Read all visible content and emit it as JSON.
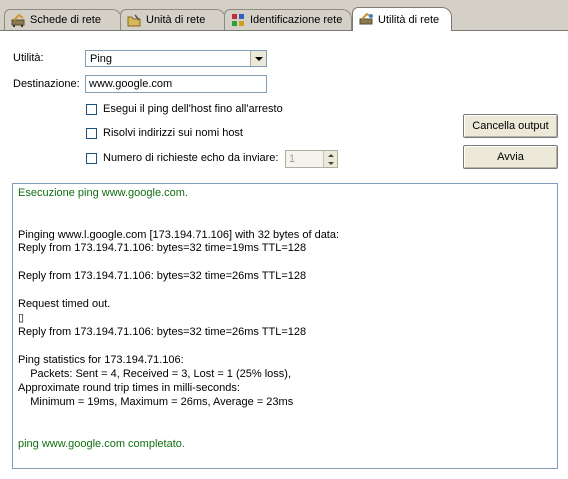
{
  "tabs": [
    {
      "label": "Schede di rete",
      "icon": "network-card-icon",
      "active": false
    },
    {
      "label": "Unità di rete",
      "icon": "folder-icon",
      "active": false
    },
    {
      "label": "Identificazione rete",
      "icon": "network-id-icon",
      "active": false
    },
    {
      "label": "Utilità di rete",
      "icon": "network-tools-icon",
      "active": true
    }
  ],
  "form": {
    "utility_label": "Utilità:",
    "utility_value": "Ping",
    "destination_label": "Destinazione:",
    "destination_value": "www.google.com",
    "checkbox_continuous": "Esegui il ping dell'host fino all'arresto",
    "checkbox_resolve": "Risolvi indirizzi sui nomi host",
    "checkbox_count": "Numero di richieste echo da inviare:",
    "count_value": "1"
  },
  "buttons": {
    "clear_output": "Cancella output",
    "start": "Avvia"
  },
  "output": {
    "start_line": "Esecuzione ping www.google.com.",
    "lines": [
      "Pinging www.l.google.com [173.194.71.106] with 32 bytes of data:",
      "Reply from 173.194.71.106: bytes=32 time=19ms TTL=128",
      "Reply from 173.194.71.106: bytes=32 time=26ms TTL=128",
      "Request timed out.",
      "▯",
      "Reply from 173.194.71.106: bytes=32 time=26ms TTL=128",
      "Ping statistics for 173.194.71.106:",
      "    Packets: Sent = 4, Received = 3, Lost = 1 (25% loss),",
      "Approximate round trip times in milli-seconds:",
      "    Minimum = 19ms, Maximum = 26ms, Average = 23ms"
    ],
    "end_line": "ping www.google.com completato."
  },
  "colors": {
    "status_text": "#107010",
    "panel_bg": "#ffffff",
    "window_bg": "#d4d0c8"
  }
}
